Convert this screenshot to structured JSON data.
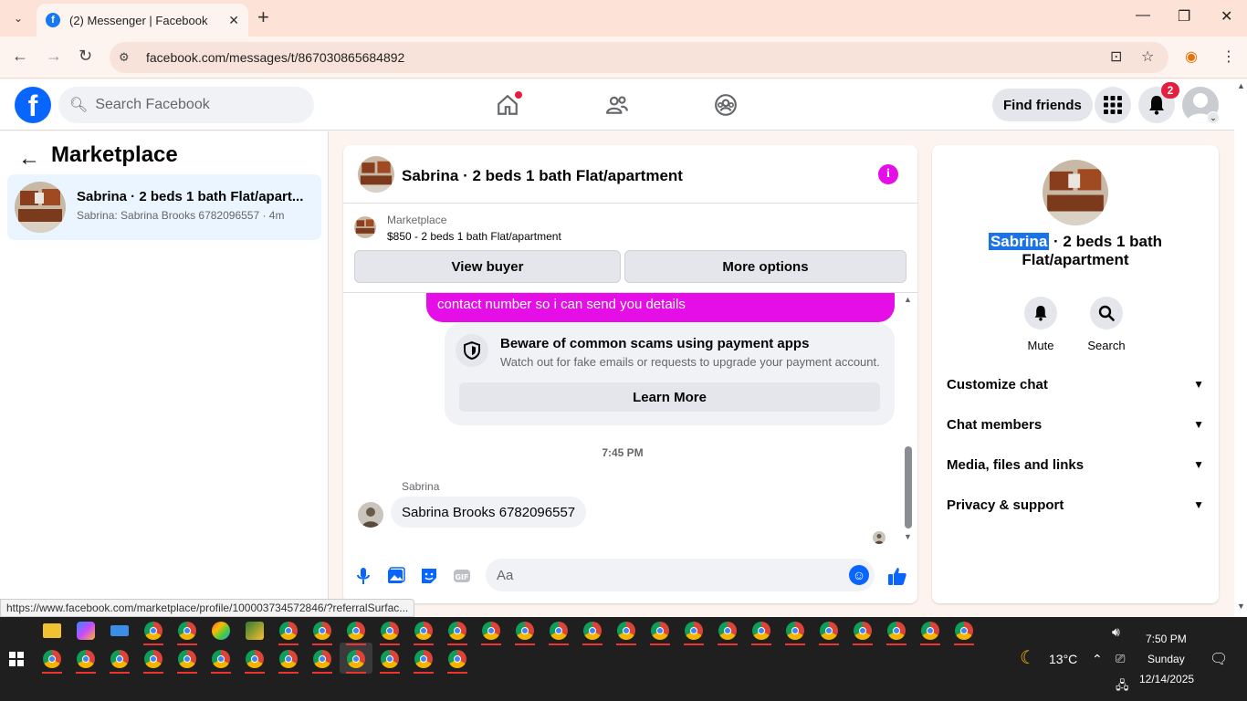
{
  "browser": {
    "tab_title": "(2) Messenger | Facebook",
    "url": "facebook.com/messages/t/867030865684892",
    "status_url": "https://www.facebook.com/marketplace/profile/100003734572846/?referralSurfac..."
  },
  "fb": {
    "search_placeholder": "Search Facebook",
    "find_friends": "Find friends",
    "notif_count": "2"
  },
  "left": {
    "title": "Marketplace",
    "conversation": {
      "name": "Sabrina · 2 beds 1 bath Flat/apart...",
      "preview": "Sabrina: Sabrina Brooks 6782096557 · 4m"
    }
  },
  "chat": {
    "title": "Sabrina · 2 beds 1 bath Flat/apartment",
    "marketplace_label": "Marketplace",
    "listing": "$850 - 2 beds 1 bath Flat/apartment",
    "view_buyer": "View buyer",
    "more_options": "More options",
    "outgoing_text": "contact number so i can send you details",
    "scam_title": "Beware of common scams using payment apps",
    "scam_sub": "Watch out for fake emails or requests to upgrade your payment account.",
    "learn_more": "Learn More",
    "timestamp": "7:45 PM",
    "sender": "Sabrina",
    "incoming_text": "Sabrina Brooks 6782096557",
    "composer_placeholder": "Aa"
  },
  "right": {
    "name_selected": "Sabrina",
    "name_rest": " · 2 beds 1 bath",
    "name_line2": "Flat/apartment",
    "mute": "Mute",
    "search": "Search",
    "rows": [
      "Customize chat",
      "Chat members",
      "Media, files and links",
      "Privacy & support"
    ]
  },
  "taskbar": {
    "weather": "13°C",
    "time": "7:50 PM",
    "day": "Sunday",
    "date": "12/14/2025"
  },
  "colors": {
    "accent": "#e60ee6",
    "fb_blue": "#0866ff"
  }
}
